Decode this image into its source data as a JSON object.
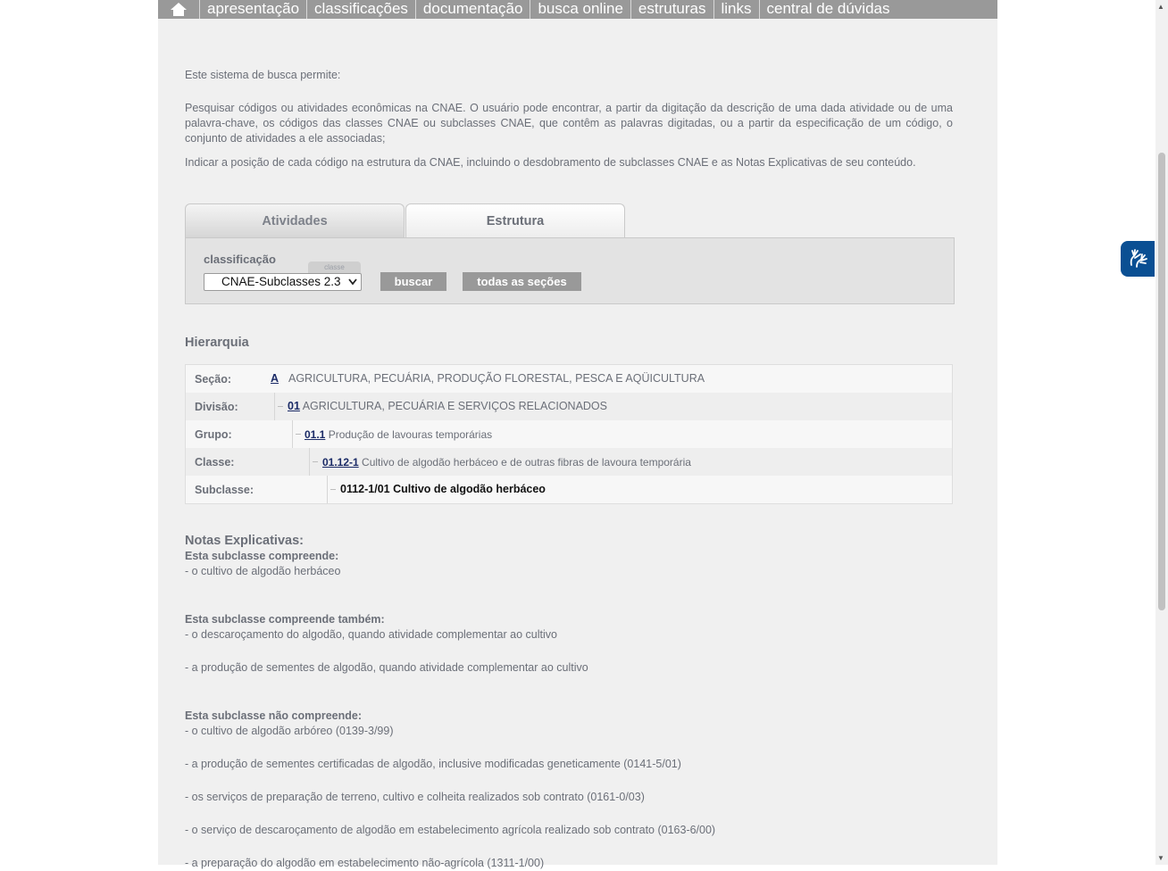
{
  "nav": {
    "home_icon": "home-icon",
    "items": [
      "apresentação",
      "classificações",
      "documentação",
      "busca online",
      "estruturas",
      "links",
      "central de dúvidas"
    ]
  },
  "intro": {
    "p1": "Este sistema de busca permite:",
    "p2": "Pesquisar códigos ou atividades econômicas na CNAE. O usuário pode encontrar, a partir da digitação da descrição de uma dada atividade ou de uma palavra-chave, os códigos das classes CNAE ou subclasses CNAE, que contêm as palavras digitadas, ou a partir da especificação de um código, o conjunto de atividades a ele associadas;",
    "p3": "Indicar a posição de cada código na estrutura da CNAE, incluindo o desdobramento de subclasses CNAE e as Notas Explicativas de seu conteúdo."
  },
  "tabs": [
    "Atividades",
    "Estrutura"
  ],
  "search": {
    "label": "classificação",
    "badge": "classe",
    "selected": "CNAE-Subclasses 2.3",
    "buscar": "buscar",
    "todas": "todas as seções"
  },
  "hierarquia": {
    "title": "Hierarquia",
    "rows": [
      {
        "label": "Seção:",
        "code": "A",
        "text": "AGRICULTURA, PECUÁRIA, PRODUÇÃO FLORESTAL, PESCA E AQÜICULTURA"
      },
      {
        "label": "Divisão:",
        "code": "01",
        "text": "AGRICULTURA, PECUÁRIA E SERVIÇOS RELACIONADOS"
      },
      {
        "label": "Grupo:",
        "code": "01.1",
        "text": "Produção de lavouras temporárias"
      },
      {
        "label": "Classe:",
        "code": "01.12-1",
        "text": "Cultivo de algodão herbáceo e de outras fibras de lavoura temporária"
      },
      {
        "label": "Subclasse:",
        "code": "",
        "text": "0112-1/01 Cultivo de algodão herbáceo"
      }
    ]
  },
  "notas": {
    "title": "Notas Explicativas:",
    "compreende_title": "Esta subclasse compreende:",
    "compreende": [
      "- o cultivo de algodão herbáceo"
    ],
    "tambem_title": "Esta subclasse compreende também:",
    "tambem": [
      "- o descaroçamento do algodão, quando atividade complementar ao cultivo",
      "- a produção de sementes de algodão, quando atividade complementar ao cultivo"
    ],
    "nao_title": "Esta subclasse não compreende:",
    "nao": [
      "- o cultivo de algodão arbóreo (0139-3/99)",
      "- a produção de sementes certificadas de algodão, inclusive modificadas geneticamente (0141-5/01)",
      "- os serviços de preparação de terreno, cultivo e colheita realizados sob contrato (0161-0/03)",
      "- o serviço de descaroçamento de algodão em estabelecimento agrícola realizado sob contrato (0163-6/00)",
      "- a preparação do algodão em estabelecimento não-agrícola (1311-1/00)"
    ]
  },
  "accessibility_icon": "sign-language-icon"
}
